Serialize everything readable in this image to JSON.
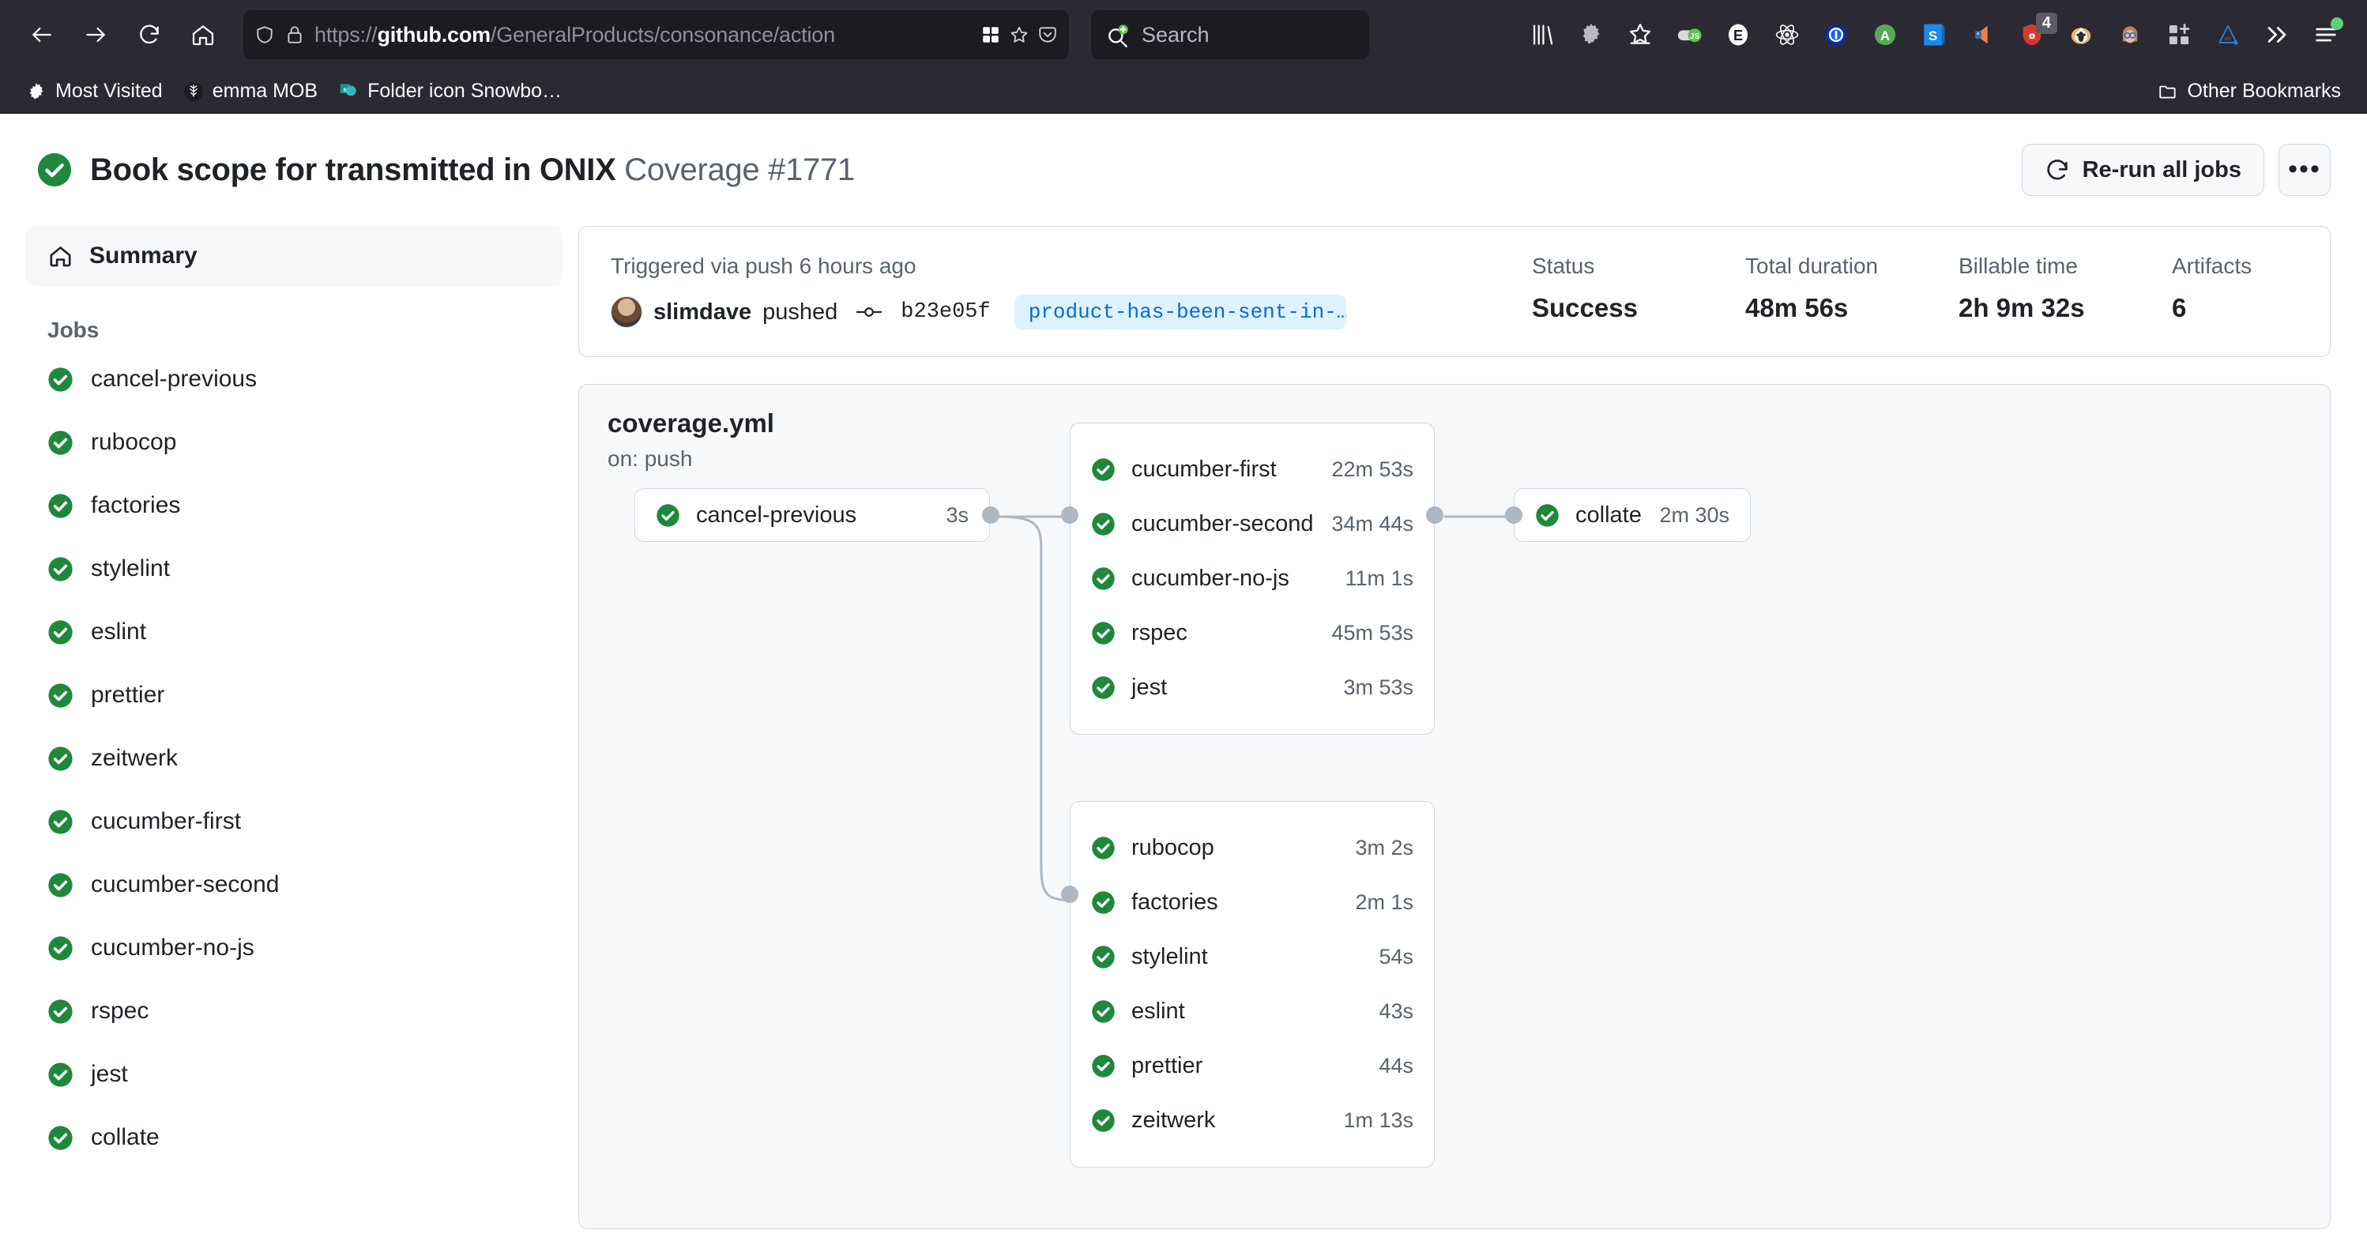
{
  "browser": {
    "url_protocol": "https://",
    "url_domain": "github.com",
    "url_path": "/GeneralProducts/consonance/action",
    "search_placeholder": "Search",
    "extension_badge": "4",
    "bookmarks": [
      {
        "label": "Most Visited",
        "icon": "gear-icon"
      },
      {
        "label": "emma MOB",
        "icon": "tree-icon"
      },
      {
        "label": "Folder icon Snowbo…",
        "icon": "sharepoint-icon"
      }
    ],
    "other_bookmarks": "Other Bookmarks"
  },
  "header": {
    "title": "Book scope for transmitted in ONIX",
    "subtitle": "Coverage #1771",
    "rerun_label": "Re-run all jobs",
    "more_label": "•••"
  },
  "sidebar": {
    "summary_label": "Summary",
    "jobs_label": "Jobs",
    "jobs": [
      {
        "label": "cancel-previous"
      },
      {
        "label": "rubocop"
      },
      {
        "label": "factories"
      },
      {
        "label": "stylelint"
      },
      {
        "label": "eslint"
      },
      {
        "label": "prettier"
      },
      {
        "label": "zeitwerk"
      },
      {
        "label": "cucumber-first"
      },
      {
        "label": "cucumber-second"
      },
      {
        "label": "cucumber-no-js"
      },
      {
        "label": "rspec"
      },
      {
        "label": "jest"
      },
      {
        "label": "collate"
      }
    ]
  },
  "summary": {
    "trigger_text": "Triggered via push 6 hours ago",
    "pusher": "slimdave",
    "pushed_word": "pushed",
    "commit_sha": "b23e05f",
    "branch": "product-has-been-sent-in-…",
    "stats": [
      {
        "label": "Status",
        "value": "Success"
      },
      {
        "label": "Total duration",
        "value": "48m 56s"
      },
      {
        "label": "Billable time",
        "value": "2h 9m 32s"
      },
      {
        "label": "Artifacts",
        "value": "6"
      }
    ]
  },
  "graph": {
    "workflow_file": "coverage.yml",
    "workflow_on": "on: push",
    "start_node": {
      "label": "cancel-previous",
      "time": "3s"
    },
    "test_group": [
      {
        "label": "cucumber-first",
        "time": "22m 53s"
      },
      {
        "label": "cucumber-second",
        "time": "34m 44s"
      },
      {
        "label": "cucumber-no-js",
        "time": "11m 1s"
      },
      {
        "label": "rspec",
        "time": "45m 53s"
      },
      {
        "label": "jest",
        "time": "3m 53s"
      }
    ],
    "lint_group": [
      {
        "label": "rubocop",
        "time": "3m 2s"
      },
      {
        "label": "factories",
        "time": "2m 1s"
      },
      {
        "label": "stylelint",
        "time": "54s"
      },
      {
        "label": "eslint",
        "time": "43s"
      },
      {
        "label": "prettier",
        "time": "44s"
      },
      {
        "label": "zeitwerk",
        "time": "1m 13s"
      }
    ],
    "collate_node": {
      "label": "collate",
      "time": "2m 30s"
    }
  },
  "colors": {
    "success_green": "#1f883d",
    "link_blue": "#0969da",
    "border": "#d1d9e0",
    "canvas_subtle": "#f6f8fa",
    "chrome_bg": "#2b2a33"
  }
}
